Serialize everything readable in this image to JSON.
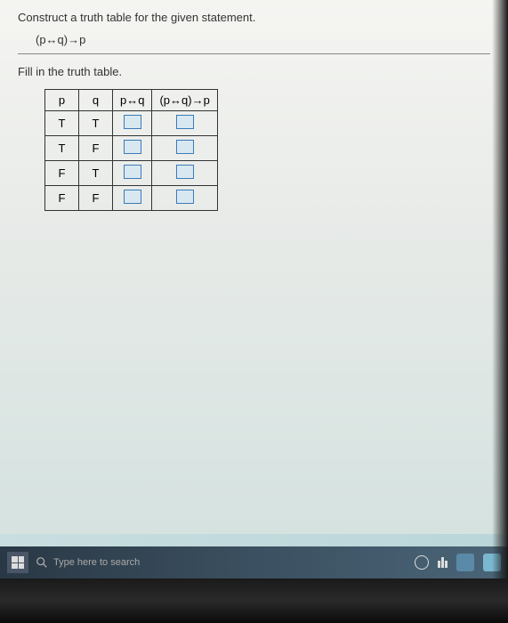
{
  "question": {
    "prompt": "Construct a truth table for the given statement.",
    "formula": "(p↔q)→p",
    "instruction": "Fill in the truth table."
  },
  "table": {
    "headers": {
      "col1": "p",
      "col2": "q",
      "col3": "p↔q",
      "col4": "(p↔q)→p"
    },
    "rows": [
      {
        "p": "T",
        "q": "T"
      },
      {
        "p": "T",
        "q": "F"
      },
      {
        "p": "F",
        "q": "T"
      },
      {
        "p": "F",
        "q": "F"
      }
    ]
  },
  "taskbar": {
    "search_placeholder": "Type here to search",
    "cortana_label": "O"
  }
}
